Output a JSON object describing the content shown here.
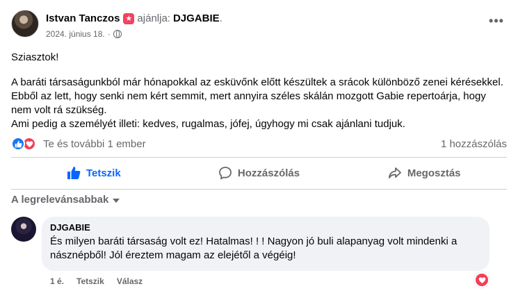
{
  "post": {
    "author": "Istvan Tanczos",
    "recommends_text": "ajánlja:",
    "page": "DJGABIE",
    "date": "2024. június 18.",
    "greeting": "Sziasztok!",
    "paragraph1": "A baráti társaságunkból már hónapokkal az esküvőnk előtt készültek a srácok különböző zenei kérésekkel. Ebből az lett, hogy senki nem kért semmit, mert annyira széles skálán mozgott Gabie repertoárja, hogy nem volt rá szükség.",
    "paragraph2": "Ami pedig a személyét illeti: kedves, rugalmas, jófej, úgyhogy mi csak ajánlani tudjuk."
  },
  "reactions": {
    "summary": "Te és további 1 ember",
    "comment_count": "1 hozzászólás"
  },
  "actions": {
    "like": "Tetszik",
    "comment": "Hozzászólás",
    "share": "Megosztás"
  },
  "sort": {
    "label": "A legrelevánsabbak"
  },
  "comment": {
    "author": "DJGABIE",
    "text": "És milyen baráti társaság volt ez! Hatalmas! ! ! Nagyon jó buli alapanyag volt mindenki a násznépből! Jól éreztem magam az elejétől a végéig!",
    "time": "1 é.",
    "like": "Tetszik",
    "reply": "Válasz"
  },
  "colors": {
    "accent": "#0866ff",
    "love": "#f33e58",
    "secondary_text": "#65676b",
    "bubble": "#f0f2f5"
  },
  "icons": {
    "recommend": "star-badge-icon",
    "privacy": "globe-icon",
    "more": "more-dots-icon",
    "like": "thumbs-up-icon",
    "comment": "speech-bubble-icon",
    "share": "share-arrow-icon",
    "love": "heart-icon",
    "sort": "caret-down-icon"
  }
}
